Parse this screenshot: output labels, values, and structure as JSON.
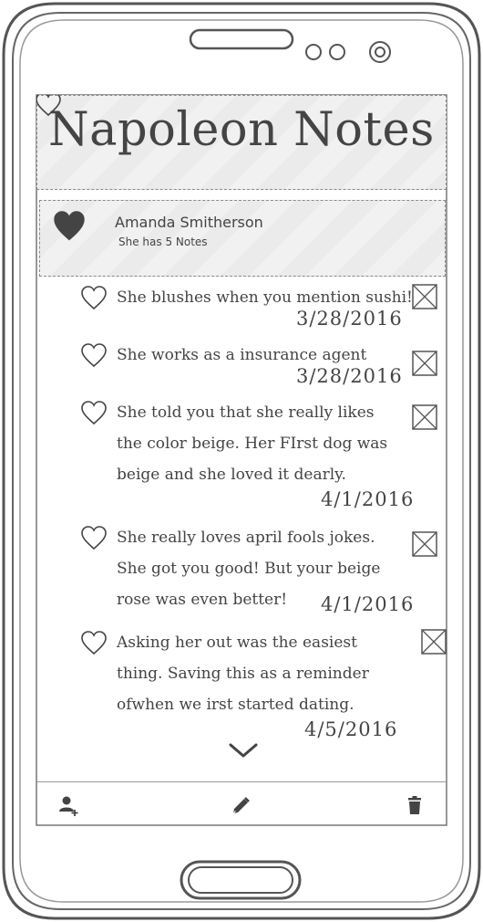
{
  "app": {
    "title": "Napoleon Notes"
  },
  "profile": {
    "name": "Amanda Smitherson",
    "subtitle": "She has 5 Notes"
  },
  "notes": [
    {
      "text": "She blushes when you mention sushi!",
      "date": "3/28/2016"
    },
    {
      "text": "She works as a insurance agent",
      "date": "3/28/2016"
    },
    {
      "text": "She told you that she really likes the color beige. Her FIrst dog was beige and she loved it dearly.",
      "date": "4/1/2016"
    },
    {
      "text": "She really loves april fools jokes. She got you good! But your beige rose was even better!",
      "date": "4/1/2016"
    },
    {
      "text": "Asking her out was the easiest thing. Saving this as a reminder ofwhen we irst started dating.",
      "date": "4/5/2016"
    }
  ],
  "icons": {
    "header": "heart-outline-icon",
    "profile": "heart-filled-icon",
    "note": "heart-outline-icon",
    "delete": "checkbox-x-icon",
    "more": "chevron-down-icon",
    "bottombar": [
      "add-user-icon",
      "pencil-icon",
      "trash-icon"
    ]
  },
  "colors": {
    "ink": "#444444",
    "panel": "#eeeeee",
    "frame": "#555555"
  }
}
